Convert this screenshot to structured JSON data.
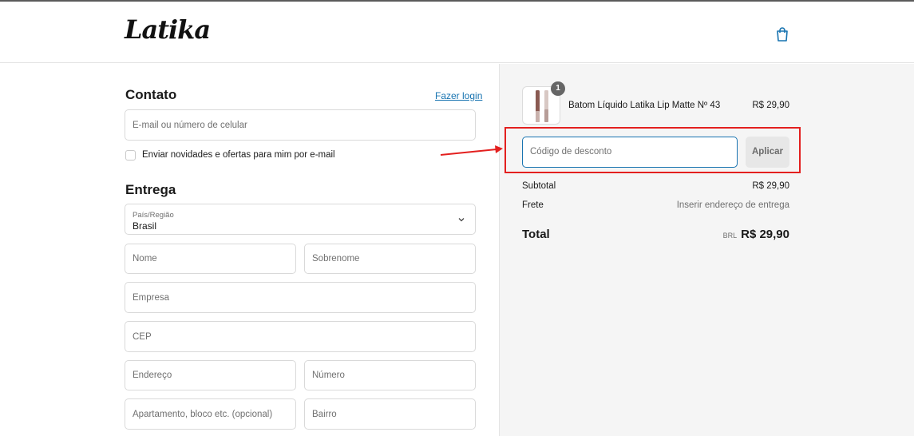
{
  "header": {
    "logo_text": "Latika",
    "bag_icon": "shopping-bag-icon"
  },
  "contact": {
    "title": "Contato",
    "login_link": "Fazer login",
    "email_placeholder": "E-mail ou número de celular",
    "newsletter_label": "Enviar novidades e ofertas para mim por e-mail"
  },
  "delivery": {
    "title": "Entrega",
    "country_label": "País/Região",
    "country_value": "Brasil",
    "first_name_placeholder": "Nome",
    "last_name_placeholder": "Sobrenome",
    "company_placeholder": "Empresa",
    "zip_placeholder": "CEP",
    "address_placeholder": "Endereço",
    "number_placeholder": "Número",
    "apartment_placeholder": "Apartamento, bloco etc. (opcional)",
    "district_placeholder": "Bairro"
  },
  "order": {
    "item_quantity": "1",
    "item_name": "Batom Líquido Latika Lip Matte Nº 43",
    "item_price": "R$ 29,90",
    "discount_placeholder": "Código de desconto",
    "apply_label": "Aplicar",
    "subtotal_label": "Subtotal",
    "subtotal_value": "R$ 29,90",
    "shipping_label": "Frete",
    "shipping_value": "Inserir endereço de entrega",
    "total_label": "Total",
    "total_currency": "BRL",
    "total_value": "R$ 29,90"
  },
  "colors": {
    "accent": "#1773b0",
    "annotation": "#e3201f",
    "summary_bg": "#f5f5f5"
  }
}
